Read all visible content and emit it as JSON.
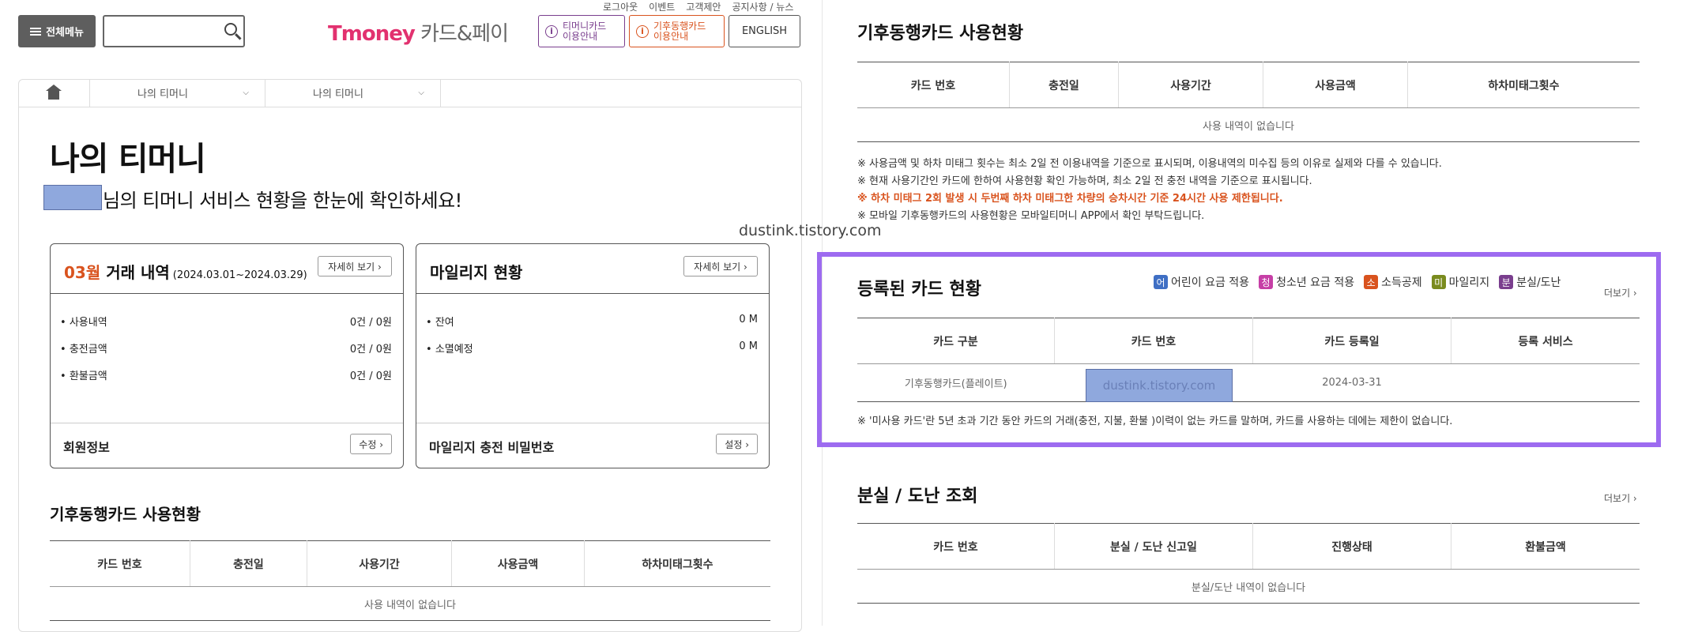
{
  "header": {
    "menu_label": "전체메뉴",
    "search_placeholder": "",
    "logo_t": "T",
    "logo_money": "money",
    "logo_rest": " 카드&페이",
    "top_links": [
      "로그아웃",
      "이벤트",
      "고객제안",
      "공지사항 / 뉴스"
    ],
    "guide_tmoney": [
      "티머니카드",
      "이용안내"
    ],
    "guide_climate": [
      "기후동행카드",
      "이용안내"
    ],
    "english_label": "ENGLISH"
  },
  "breadcrumb": {
    "items": [
      "나의 티머니",
      "나의 티머니"
    ]
  },
  "page": {
    "title": "나의 티머니",
    "subtitle": "님의 티머니 서비스 현황을 한눈에 확인하세요!"
  },
  "transactions_card": {
    "month": "03월",
    "title": " 거래 내역",
    "range": "(2024.03.01~2024.03.29)",
    "detail_btn": "자세히 보기 ›",
    "rows": [
      {
        "label": "사용내역",
        "value": "0건 / 0원"
      },
      {
        "label": "충전금액",
        "value": "0건 / 0원"
      },
      {
        "label": "환불금액",
        "value": "0건 / 0원"
      }
    ],
    "footer_label": "회원정보",
    "footer_btn": "수정 ›"
  },
  "mileage_card": {
    "title": "마일리지 현황",
    "detail_btn": "자세히 보기 ›",
    "rows": [
      {
        "label": "잔여",
        "value": "0 M"
      },
      {
        "label": "소멸예정",
        "value": "0 M"
      }
    ],
    "footer_label": "마일리지 충전 비밀번호",
    "footer_btn": "설정 ›"
  },
  "climate_usage": {
    "title": "기후동행카드 사용현황",
    "columns": [
      "카드 번호",
      "충전일",
      "사용기간",
      "사용금액",
      "하차미태그횟수"
    ],
    "empty": "사용 내역이 없습니다",
    "notes": [
      "※ 사용금액 및 하차 미태그 횟수는 최소 2일 전 이용내역을 기준으로 표시되며, 이용내역의 미수집 등의 이유로 실제와 다를 수 있습니다.",
      "※ 현재 사용기간인 카드에 한하여 사용현황 확인 가능하며, 최소 2일 전 충전 내역을 기준으로 표시됩니다.",
      "※ 하차 미태그 2회 발생 시 두번째 하차 미태그한 차량의 승차시간 기준 24시간 사용 제한됩니다.",
      "※ 모바일 기후동행카드의 사용현황은 모바일티머니 APP에서 확인 부탁드립니다."
    ]
  },
  "watermark": "dustink.tistory.com",
  "registered_cards": {
    "title": "등록된 카드 현황",
    "legend": [
      {
        "mark": "어",
        "label": "어린이 요금 적용",
        "color": "#3f6fc4"
      },
      {
        "mark": "청",
        "label": "청소년 요금 적용",
        "color": "#c63fa6"
      },
      {
        "mark": "소",
        "label": "소득공제",
        "color": "#d9531e"
      },
      {
        "mark": "미",
        "label": "마일리지",
        "color": "#7a8b1e"
      },
      {
        "mark": "분",
        "label": "분실/도난",
        "color": "#7a3e8e"
      }
    ],
    "more": "더보기 ›",
    "columns": [
      "카드 구분",
      "카드 번호",
      "카드 등록일",
      "등록 서비스"
    ],
    "row": {
      "type": "기후동행카드(플레이트)",
      "number": "dustink.tistory.com",
      "date": "2024-03-31",
      "service": ""
    },
    "note": "※ '미사용 카드'란 5년 초과 기간 동안 카드의 거래(충전, 지불, 환불 )이력이 없는 카드를 말하며, 카드를 사용하는 데에는 제한이 없습니다."
  },
  "loss": {
    "title": "분실 / 도난 조회",
    "more": "더보기 ›",
    "columns": [
      "카드 번호",
      "분실 / 도난 신고일",
      "진행상태",
      "환불금액"
    ],
    "empty": "분실/도난 내역이 없습니다"
  }
}
